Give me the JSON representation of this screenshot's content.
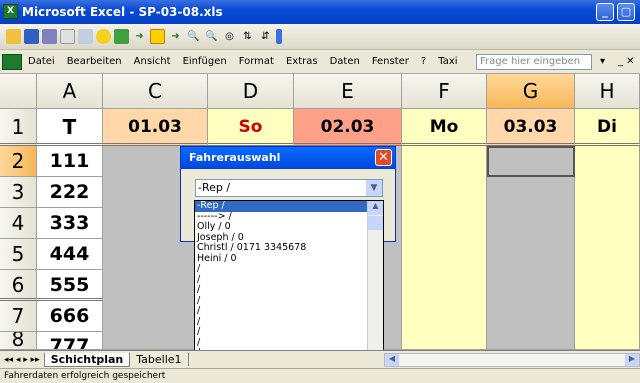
{
  "window": {
    "title": "Microsoft Excel - SP-03-08.xls"
  },
  "menu": {
    "items": [
      "Datei",
      "Bearbeiten",
      "Ansicht",
      "Einfügen",
      "Format",
      "Extras",
      "Daten",
      "Fenster",
      "?",
      "Taxi"
    ],
    "help_placeholder": "Frage hier eingeben"
  },
  "grid": {
    "columns": [
      "A",
      "C",
      "D",
      "E",
      "F",
      "G",
      "H"
    ],
    "rows": [
      "1",
      "2",
      "3",
      "4",
      "5",
      "6",
      "7",
      "8"
    ],
    "row1": [
      "T",
      "01.03",
      "So",
      "02.03",
      "Mo",
      "03.03",
      "Di"
    ],
    "col_a": [
      "111",
      "222",
      "333",
      "444",
      "555",
      "666",
      "777"
    ]
  },
  "dialog": {
    "title": "Fahrerauswahl",
    "combo_value": "-Rep /",
    "options": [
      "-Rep /",
      "------> /",
      "Olly / 0",
      "Joseph / 0",
      "Christl / 0171 3345678",
      "Heini / 0",
      "/",
      "/",
      "/",
      "/",
      "/",
      "/",
      "/",
      "/",
      "/",
      "/",
      "/"
    ]
  },
  "sheets": {
    "tabs": [
      "Schichtplan",
      "Tabelle1"
    ]
  },
  "status": {
    "text": "Fahrerdaten erfolgreich gespeichert"
  },
  "colors": {
    "accent": "#0a4bd6",
    "cell_orange": "#ffd7a8",
    "cell_yellow": "#ffffc0",
    "cell_grey": "#c0c0c0",
    "red_text": "#d00000"
  }
}
